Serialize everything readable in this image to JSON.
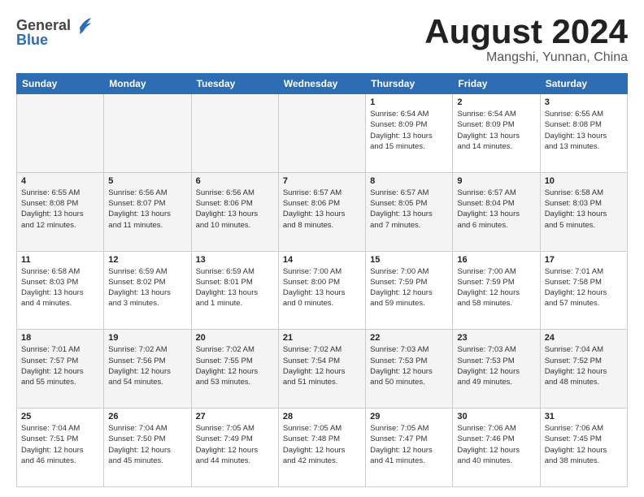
{
  "header": {
    "logo_general": "General",
    "logo_blue": "Blue",
    "month_title": "August 2024",
    "subtitle": "Mangshi, Yunnan, China"
  },
  "days_of_week": [
    "Sunday",
    "Monday",
    "Tuesday",
    "Wednesday",
    "Thursday",
    "Friday",
    "Saturday"
  ],
  "weeks": [
    [
      {
        "day": "",
        "info": ""
      },
      {
        "day": "",
        "info": ""
      },
      {
        "day": "",
        "info": ""
      },
      {
        "day": "",
        "info": ""
      },
      {
        "day": "1",
        "info": "Sunrise: 6:54 AM\nSunset: 8:09 PM\nDaylight: 13 hours\nand 15 minutes."
      },
      {
        "day": "2",
        "info": "Sunrise: 6:54 AM\nSunset: 8:09 PM\nDaylight: 13 hours\nand 14 minutes."
      },
      {
        "day": "3",
        "info": "Sunrise: 6:55 AM\nSunset: 8:08 PM\nDaylight: 13 hours\nand 13 minutes."
      }
    ],
    [
      {
        "day": "4",
        "info": "Sunrise: 6:55 AM\nSunset: 8:08 PM\nDaylight: 13 hours\nand 12 minutes."
      },
      {
        "day": "5",
        "info": "Sunrise: 6:56 AM\nSunset: 8:07 PM\nDaylight: 13 hours\nand 11 minutes."
      },
      {
        "day": "6",
        "info": "Sunrise: 6:56 AM\nSunset: 8:06 PM\nDaylight: 13 hours\nand 10 minutes."
      },
      {
        "day": "7",
        "info": "Sunrise: 6:57 AM\nSunset: 8:06 PM\nDaylight: 13 hours\nand 8 minutes."
      },
      {
        "day": "8",
        "info": "Sunrise: 6:57 AM\nSunset: 8:05 PM\nDaylight: 13 hours\nand 7 minutes."
      },
      {
        "day": "9",
        "info": "Sunrise: 6:57 AM\nSunset: 8:04 PM\nDaylight: 13 hours\nand 6 minutes."
      },
      {
        "day": "10",
        "info": "Sunrise: 6:58 AM\nSunset: 8:03 PM\nDaylight: 13 hours\nand 5 minutes."
      }
    ],
    [
      {
        "day": "11",
        "info": "Sunrise: 6:58 AM\nSunset: 8:03 PM\nDaylight: 13 hours\nand 4 minutes."
      },
      {
        "day": "12",
        "info": "Sunrise: 6:59 AM\nSunset: 8:02 PM\nDaylight: 13 hours\nand 3 minutes."
      },
      {
        "day": "13",
        "info": "Sunrise: 6:59 AM\nSunset: 8:01 PM\nDaylight: 13 hours\nand 1 minute."
      },
      {
        "day": "14",
        "info": "Sunrise: 7:00 AM\nSunset: 8:00 PM\nDaylight: 13 hours\nand 0 minutes."
      },
      {
        "day": "15",
        "info": "Sunrise: 7:00 AM\nSunset: 7:59 PM\nDaylight: 12 hours\nand 59 minutes."
      },
      {
        "day": "16",
        "info": "Sunrise: 7:00 AM\nSunset: 7:59 PM\nDaylight: 12 hours\nand 58 minutes."
      },
      {
        "day": "17",
        "info": "Sunrise: 7:01 AM\nSunset: 7:58 PM\nDaylight: 12 hours\nand 57 minutes."
      }
    ],
    [
      {
        "day": "18",
        "info": "Sunrise: 7:01 AM\nSunset: 7:57 PM\nDaylight: 12 hours\nand 55 minutes."
      },
      {
        "day": "19",
        "info": "Sunrise: 7:02 AM\nSunset: 7:56 PM\nDaylight: 12 hours\nand 54 minutes."
      },
      {
        "day": "20",
        "info": "Sunrise: 7:02 AM\nSunset: 7:55 PM\nDaylight: 12 hours\nand 53 minutes."
      },
      {
        "day": "21",
        "info": "Sunrise: 7:02 AM\nSunset: 7:54 PM\nDaylight: 12 hours\nand 51 minutes."
      },
      {
        "day": "22",
        "info": "Sunrise: 7:03 AM\nSunset: 7:53 PM\nDaylight: 12 hours\nand 50 minutes."
      },
      {
        "day": "23",
        "info": "Sunrise: 7:03 AM\nSunset: 7:53 PM\nDaylight: 12 hours\nand 49 minutes."
      },
      {
        "day": "24",
        "info": "Sunrise: 7:04 AM\nSunset: 7:52 PM\nDaylight: 12 hours\nand 48 minutes."
      }
    ],
    [
      {
        "day": "25",
        "info": "Sunrise: 7:04 AM\nSunset: 7:51 PM\nDaylight: 12 hours\nand 46 minutes."
      },
      {
        "day": "26",
        "info": "Sunrise: 7:04 AM\nSunset: 7:50 PM\nDaylight: 12 hours\nand 45 minutes."
      },
      {
        "day": "27",
        "info": "Sunrise: 7:05 AM\nSunset: 7:49 PM\nDaylight: 12 hours\nand 44 minutes."
      },
      {
        "day": "28",
        "info": "Sunrise: 7:05 AM\nSunset: 7:48 PM\nDaylight: 12 hours\nand 42 minutes."
      },
      {
        "day": "29",
        "info": "Sunrise: 7:05 AM\nSunset: 7:47 PM\nDaylight: 12 hours\nand 41 minutes."
      },
      {
        "day": "30",
        "info": "Sunrise: 7:06 AM\nSunset: 7:46 PM\nDaylight: 12 hours\nand 40 minutes."
      },
      {
        "day": "31",
        "info": "Sunrise: 7:06 AM\nSunset: 7:45 PM\nDaylight: 12 hours\nand 38 minutes."
      }
    ]
  ]
}
